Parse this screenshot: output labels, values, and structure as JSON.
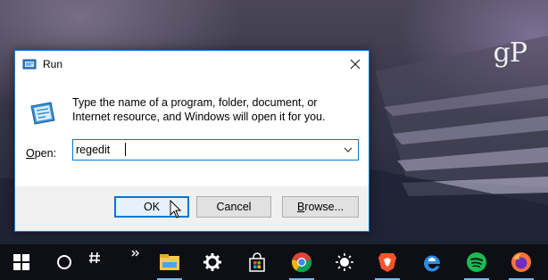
{
  "watermark": "gP",
  "dialog": {
    "title": "Run",
    "description": "Type the name of a program, folder, document, or Internet resource, and Windows will open it for you.",
    "open_label_prefix": "O",
    "open_label_rest": "pen:",
    "input_value": "regedit",
    "buttons": {
      "ok": "OK",
      "cancel": "Cancel",
      "browse_prefix": "B",
      "browse_rest": "rowse..."
    }
  },
  "taskbar": {
    "items": [
      "start-icon",
      "cortana-icon",
      "timeline-icon",
      "overflow-chevron-icon",
      "file-explorer-icon",
      "settings-icon",
      "store-icon",
      "chrome-icon",
      "sun-icon",
      "brave-icon",
      "edge-icon",
      "spotify-icon",
      "firefox-icon"
    ],
    "accent_color": "#76b9ed"
  },
  "colors": {
    "dialog_border": "#1979ca",
    "focus_blue": "#0078d7",
    "taskbar": "#0e0f14"
  }
}
